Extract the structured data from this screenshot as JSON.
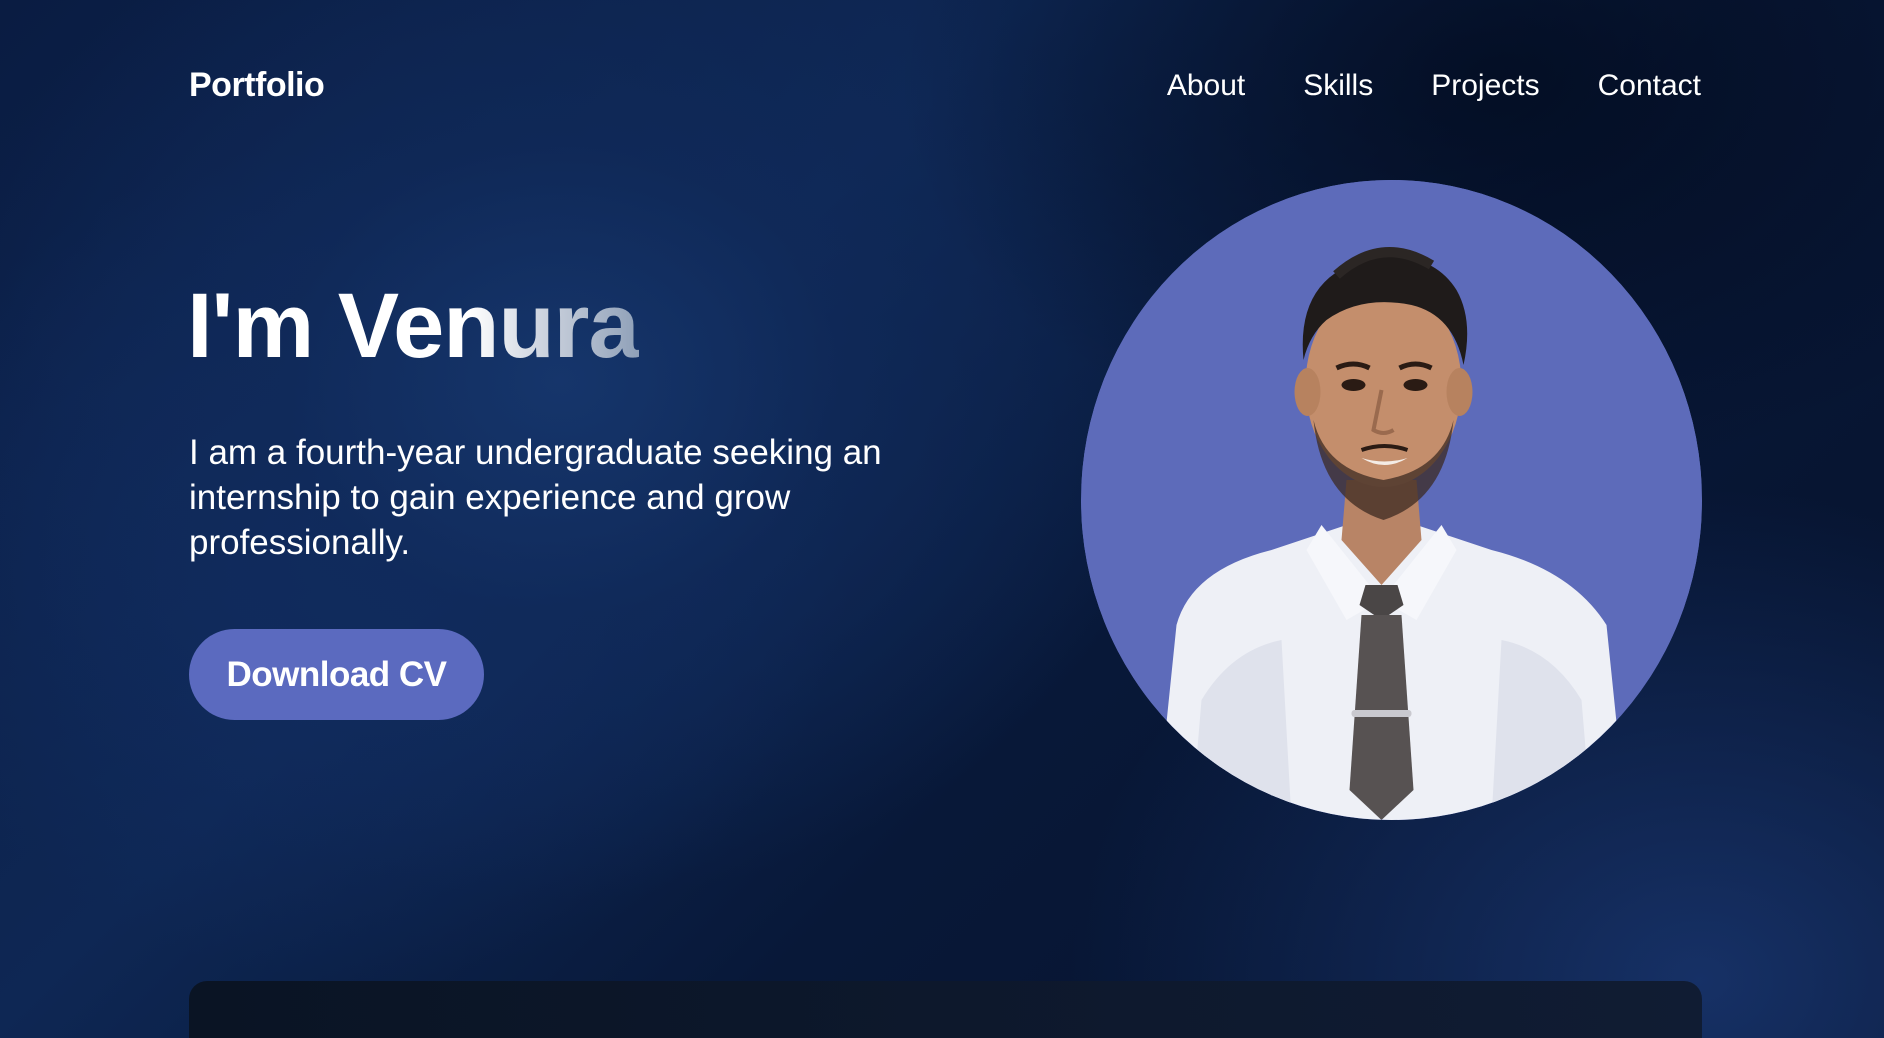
{
  "header": {
    "logo": "Portfolio",
    "nav": [
      {
        "label": "About"
      },
      {
        "label": "Skills"
      },
      {
        "label": "Projects"
      },
      {
        "label": "Contact"
      }
    ]
  },
  "hero": {
    "title": "I'm Venura",
    "description": "I am a fourth-year undergraduate seeking an internship to gain experience and grow professionally.",
    "cta_label": "Download CV"
  },
  "colors": {
    "accent": "#5b6abf",
    "avatar_background": "#5d6bba",
    "background": "#0e2754"
  }
}
